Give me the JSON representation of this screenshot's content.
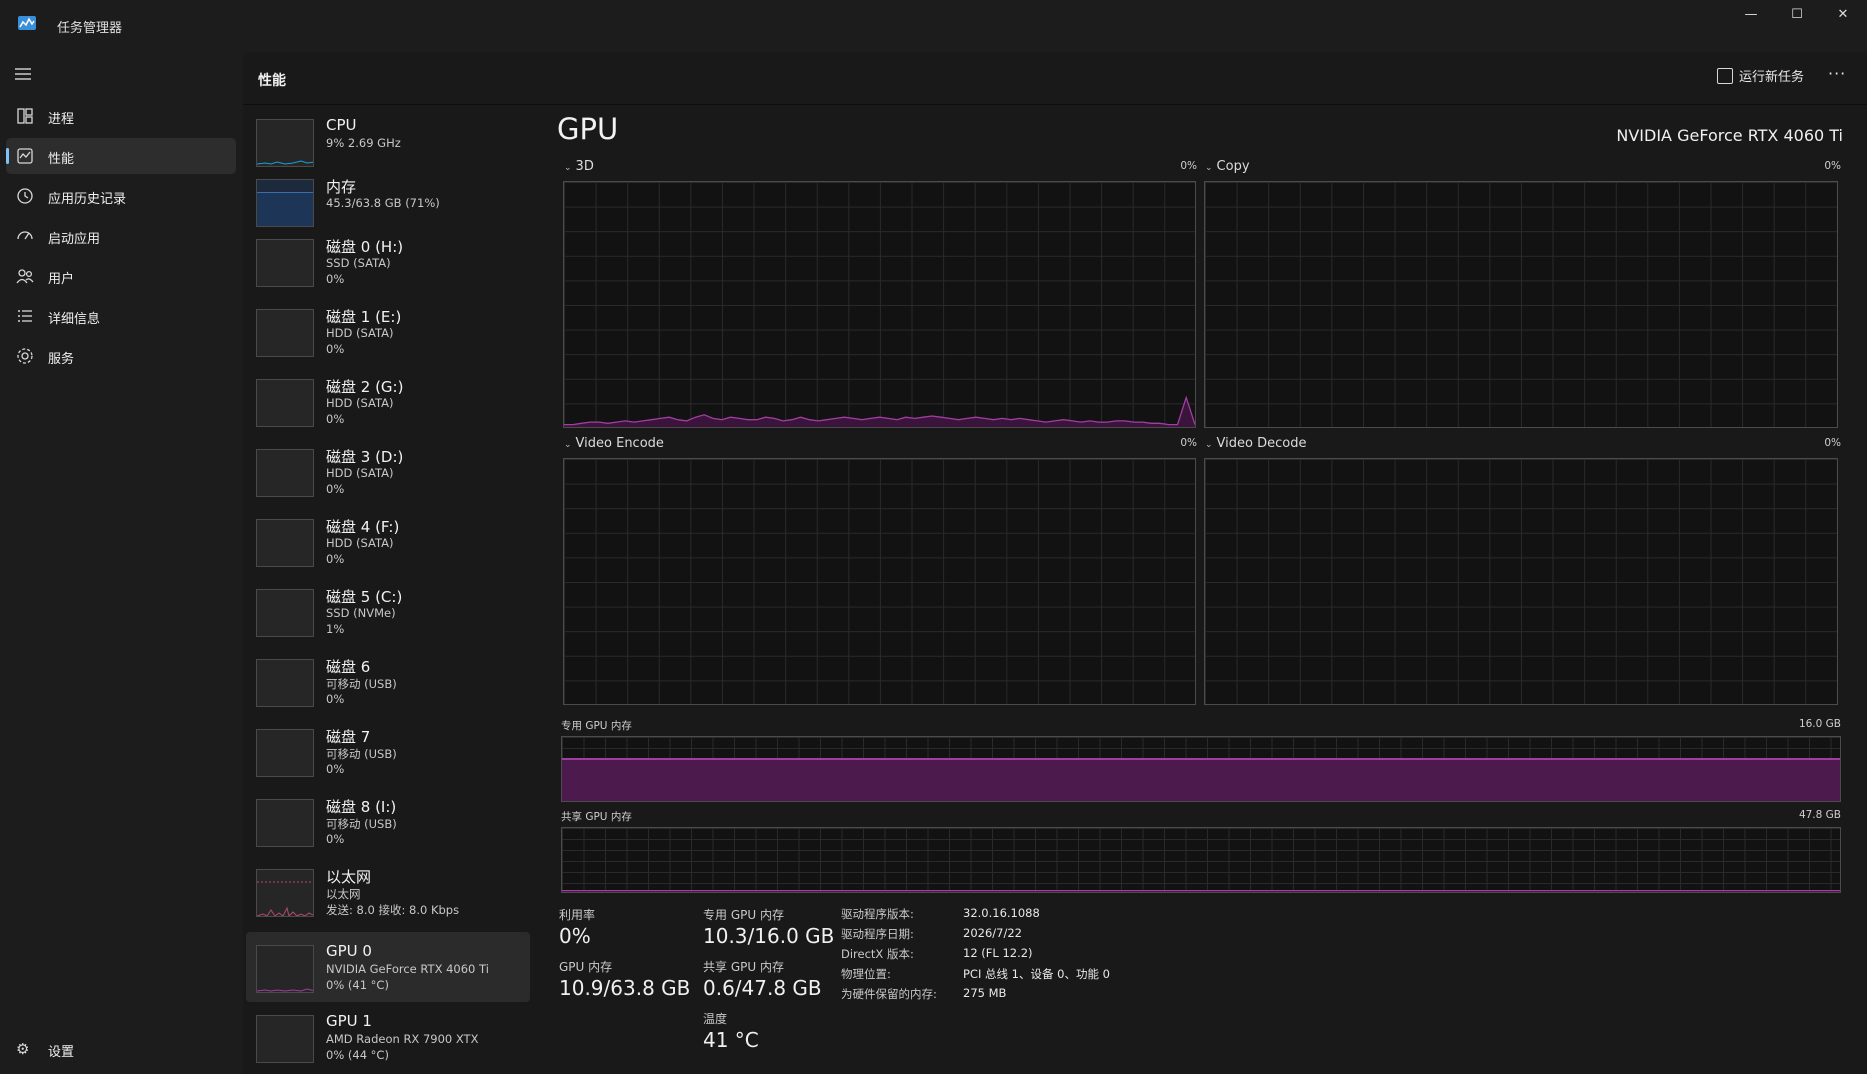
{
  "window": {
    "title": "任务管理器",
    "minimize": "—",
    "maximize": "☐",
    "close": "✕"
  },
  "nav": {
    "items": [
      {
        "label": "进程",
        "icon": "processes-icon"
      },
      {
        "label": "性能",
        "icon": "performance-icon"
      },
      {
        "label": "应用历史记录",
        "icon": "app-history-icon"
      },
      {
        "label": "启动应用",
        "icon": "startup-apps-icon"
      },
      {
        "label": "用户",
        "icon": "users-icon"
      },
      {
        "label": "详细信息",
        "icon": "details-icon"
      },
      {
        "label": "服务",
        "icon": "services-icon"
      }
    ],
    "settings": "设置"
  },
  "header": {
    "title": "性能",
    "run_task": "运行新任务",
    "more": "···"
  },
  "devices": [
    {
      "name": "CPU",
      "sub": "9% 2.69 GHz",
      "sub2": ""
    },
    {
      "name": "内存",
      "sub": "45.3/63.8 GB (71%)",
      "sub2": ""
    },
    {
      "name": "磁盘 0 (H:)",
      "sub": "SSD (SATA)",
      "sub2": "0%"
    },
    {
      "name": "磁盘 1 (E:)",
      "sub": "HDD (SATA)",
      "sub2": "0%"
    },
    {
      "name": "磁盘 2 (G:)",
      "sub": "HDD (SATA)",
      "sub2": "0%"
    },
    {
      "name": "磁盘 3 (D:)",
      "sub": "HDD (SATA)",
      "sub2": "0%"
    },
    {
      "name": "磁盘 4 (F:)",
      "sub": "HDD (SATA)",
      "sub2": "0%"
    },
    {
      "name": "磁盘 5 (C:)",
      "sub": "SSD (NVMe)",
      "sub2": "1%"
    },
    {
      "name": "磁盘 6",
      "sub": "可移动 (USB)",
      "sub2": "0%"
    },
    {
      "name": "磁盘 7",
      "sub": "可移动 (USB)",
      "sub2": "0%"
    },
    {
      "name": "磁盘 8 (I:)",
      "sub": "可移动 (USB)",
      "sub2": "0%"
    },
    {
      "name": "以太网",
      "sub": "以太网",
      "sub2": "发送: 8.0 接收: 8.0 Kbps"
    },
    {
      "name": "GPU 0",
      "sub": "NVIDIA GeForce RTX 4060 Ti",
      "sub2": "0% (41 °C)"
    },
    {
      "name": "GPU 1",
      "sub": "AMD Radeon RX 7900 XTX",
      "sub2": "0% (44 °C)"
    }
  ],
  "gpu": {
    "title": "GPU",
    "model": "NVIDIA GeForce RTX 4060 Ti",
    "engines": [
      {
        "label": "3D",
        "pct": "0%"
      },
      {
        "label": "Copy",
        "pct": "0%"
      },
      {
        "label": "Video Encode",
        "pct": "0%"
      },
      {
        "label": "Video Decode",
        "pct": "0%"
      }
    ],
    "dedicated_label": "专用 GPU 内存",
    "dedicated_max": "16.0 GB",
    "dedicated_fill": 0.64,
    "shared_label": "共享 GPU 内存",
    "shared_max": "47.8 GB",
    "shared_fill": 0.013,
    "stats": {
      "util_label": "利用率",
      "util": "0%",
      "ded_label": "专用 GPU 内存",
      "ded": "10.3/16.0 GB",
      "gpumem_label": "GPU 内存",
      "gpumem": "10.9/63.8 GB",
      "shared_label": "共享 GPU 内存",
      "shared": "0.6/47.8 GB",
      "temp_label": "温度",
      "temp": "41 °C"
    },
    "info": [
      {
        "label": "驱动程序版本:",
        "value": "32.0.16.1088"
      },
      {
        "label": "驱动程序日期:",
        "value": "2026/7/22"
      },
      {
        "label": "DirectX 版本:",
        "value": "12 (FL 12.2)"
      },
      {
        "label": "物理位置:",
        "value": "PCI 总线 1、设备 0、功能 0"
      },
      {
        "label": "为硬件保留的内存:",
        "value": "275 MB"
      }
    ],
    "graph_3d_values": [
      1,
      1,
      1.5,
      2,
      2,
      1.5,
      2,
      2.5,
      2,
      2.5,
      3,
      3.5,
      4,
      3,
      2.5,
      4,
      5,
      3.5,
      3,
      4,
      3.5,
      3,
      3,
      4,
      3.5,
      2.5,
      3,
      4,
      3,
      2.5,
      3,
      3.5,
      4,
      3.5,
      3,
      3.5,
      4,
      3.5,
      3,
      4,
      3.5,
      4,
      4.5,
      4,
      3.5,
      3,
      3.5,
      4,
      3.5,
      3,
      3.5,
      3,
      3.5,
      3,
      2.5,
      2,
      2.5,
      3,
      2.5,
      2,
      2.5,
      2,
      2,
      2.5,
      2.5,
      2,
      2,
      1.5,
      1.5,
      1,
      1,
      12,
      1
    ]
  },
  "colors": {
    "accent": "#7cc4f8",
    "gpu": "#a23ea2",
    "memory": "#3a6ea5"
  }
}
